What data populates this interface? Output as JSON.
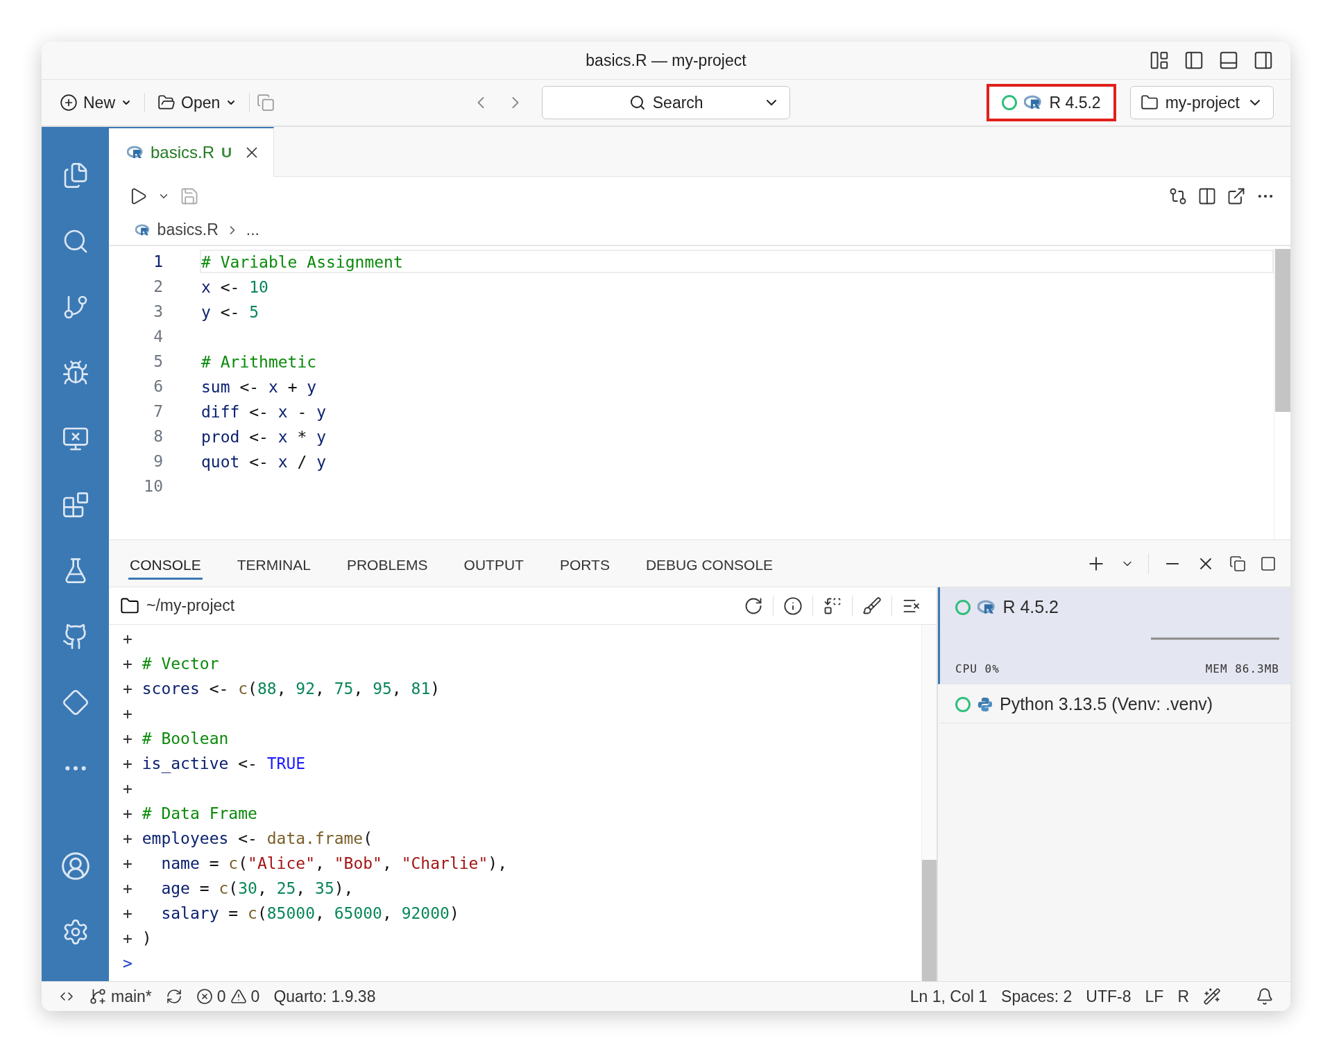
{
  "window": {
    "title": "basics.R — my-project"
  },
  "toolbar": {
    "new_button": "New",
    "open_button": "Open",
    "search": {
      "label": "Search"
    },
    "runtime": {
      "label": "R 4.5.2",
      "highlighted": true
    },
    "project": "my-project"
  },
  "editor": {
    "tab": {
      "label": "basics.R",
      "status": "U",
      "selected": true
    },
    "breadcrumb": [
      "basics.R",
      "..."
    ],
    "lines": [
      {
        "number": "1",
        "current": true,
        "tokens": [
          {
            "kind": "comment",
            "text": "# Variable Assignment"
          }
        ]
      },
      {
        "number": "2",
        "current": false,
        "tokens": [
          {
            "kind": "ident",
            "text": "x"
          },
          {
            "kind": "plain",
            "text": " <- "
          },
          {
            "kind": "number",
            "text": "10"
          }
        ]
      },
      {
        "number": "3",
        "current": false,
        "tokens": [
          {
            "kind": "ident",
            "text": "y"
          },
          {
            "kind": "plain",
            "text": " <- "
          },
          {
            "kind": "number",
            "text": "5"
          }
        ]
      },
      {
        "number": "4",
        "current": false
      },
      {
        "number": "5",
        "current": false,
        "tokens": [
          {
            "kind": "comment",
            "text": "# Arithmetic"
          }
        ]
      },
      {
        "number": "6",
        "current": false,
        "tokens": [
          {
            "kind": "ident",
            "text": "sum"
          },
          {
            "kind": "plain",
            "text": " <- "
          },
          {
            "kind": "ident",
            "text": "x"
          },
          {
            "kind": "plain",
            "text": " + "
          },
          {
            "kind": "ident",
            "text": "y"
          }
        ]
      },
      {
        "number": "7",
        "current": false,
        "tokens": [
          {
            "kind": "ident",
            "text": "diff"
          },
          {
            "kind": "plain",
            "text": " <- "
          },
          {
            "kind": "ident",
            "text": "x"
          },
          {
            "kind": "plain",
            "text": " - "
          },
          {
            "kind": "ident",
            "text": "y"
          }
        ]
      },
      {
        "number": "8",
        "current": false,
        "tokens": [
          {
            "kind": "ident",
            "text": "prod"
          },
          {
            "kind": "plain",
            "text": " <- "
          },
          {
            "kind": "ident",
            "text": "x"
          },
          {
            "kind": "plain",
            "text": " * "
          },
          {
            "kind": "ident",
            "text": "y"
          }
        ]
      },
      {
        "number": "9",
        "current": false,
        "tokens": [
          {
            "kind": "ident",
            "text": "quot"
          },
          {
            "kind": "plain",
            "text": " <- "
          },
          {
            "kind": "ident",
            "text": "x"
          },
          {
            "kind": "plain",
            "text": " / "
          },
          {
            "kind": "ident",
            "text": "y"
          }
        ]
      },
      {
        "number": "10",
        "current": false
      }
    ]
  },
  "panel": {
    "tabs": [
      {
        "label": "CONSOLE",
        "selected": true
      },
      {
        "label": "TERMINAL",
        "selected": false
      },
      {
        "label": "PROBLEMS",
        "selected": false
      },
      {
        "label": "OUTPUT",
        "selected": false
      },
      {
        "label": "PORTS",
        "selected": false
      },
      {
        "label": "DEBUG CONSOLE",
        "selected": false
      }
    ]
  },
  "console": {
    "path": "~/my-project",
    "lines": [
      {
        "kind": "continuation",
        "prompt": "+"
      },
      {
        "kind": "continuation",
        "prompt": "+",
        "tokens": [
          {
            "kind": "comment",
            "text": "# Vector"
          }
        ]
      },
      {
        "kind": "continuation",
        "prompt": "+",
        "tokens": [
          {
            "kind": "ident",
            "text": "scores"
          },
          {
            "kind": "plain",
            "text": " <- "
          },
          {
            "kind": "func",
            "text": "c"
          },
          {
            "kind": "plain",
            "text": "("
          },
          {
            "kind": "number",
            "text": "88"
          },
          {
            "kind": "plain",
            "text": ", "
          },
          {
            "kind": "number",
            "text": "92"
          },
          {
            "kind": "plain",
            "text": ", "
          },
          {
            "kind": "number",
            "text": "75"
          },
          {
            "kind": "plain",
            "text": ", "
          },
          {
            "kind": "number",
            "text": "95"
          },
          {
            "kind": "plain",
            "text": ", "
          },
          {
            "kind": "number",
            "text": "81"
          },
          {
            "kind": "plain",
            "text": ")"
          }
        ]
      },
      {
        "kind": "continuation",
        "prompt": "+"
      },
      {
        "kind": "continuation",
        "prompt": "+",
        "tokens": [
          {
            "kind": "comment",
            "text": "# Boolean"
          }
        ]
      },
      {
        "kind": "continuation",
        "prompt": "+",
        "tokens": [
          {
            "kind": "ident",
            "text": "is_active"
          },
          {
            "kind": "plain",
            "text": " <- "
          },
          {
            "kind": "keyword",
            "text": "TRUE"
          }
        ]
      },
      {
        "kind": "continuation",
        "prompt": "+"
      },
      {
        "kind": "continuation",
        "prompt": "+",
        "tokens": [
          {
            "kind": "comment",
            "text": "# Data Frame"
          }
        ]
      },
      {
        "kind": "continuation",
        "prompt": "+",
        "tokens": [
          {
            "kind": "ident",
            "text": "employees"
          },
          {
            "kind": "plain",
            "text": " <- "
          },
          {
            "kind": "func",
            "text": "data.frame"
          },
          {
            "kind": "plain",
            "text": "("
          }
        ]
      },
      {
        "kind": "continuation",
        "prompt": "+",
        "indented": true,
        "tokens": [
          {
            "kind": "ident",
            "text": "name"
          },
          {
            "kind": "plain",
            "text": " = "
          },
          {
            "kind": "func",
            "text": "c"
          },
          {
            "kind": "plain",
            "text": "("
          },
          {
            "kind": "string",
            "text": "\"Alice\""
          },
          {
            "kind": "plain",
            "text": ", "
          },
          {
            "kind": "string",
            "text": "\"Bob\""
          },
          {
            "kind": "plain",
            "text": ", "
          },
          {
            "kind": "string",
            "text": "\"Charlie\""
          },
          {
            "kind": "plain",
            "text": "),"
          }
        ]
      },
      {
        "kind": "continuation",
        "prompt": "+",
        "indented": true,
        "tokens": [
          {
            "kind": "ident",
            "text": "age"
          },
          {
            "kind": "plain",
            "text": " = "
          },
          {
            "kind": "func",
            "text": "c"
          },
          {
            "kind": "plain",
            "text": "("
          },
          {
            "kind": "number",
            "text": "30"
          },
          {
            "kind": "plain",
            "text": ", "
          },
          {
            "kind": "number",
            "text": "25"
          },
          {
            "kind": "plain",
            "text": ", "
          },
          {
            "kind": "number",
            "text": "35"
          },
          {
            "kind": "plain",
            "text": "),"
          }
        ]
      },
      {
        "kind": "continuation",
        "prompt": "+",
        "indented": true,
        "tokens": [
          {
            "kind": "ident",
            "text": "salary"
          },
          {
            "kind": "plain",
            "text": " = "
          },
          {
            "kind": "func",
            "text": "c"
          },
          {
            "kind": "plain",
            "text": "("
          },
          {
            "kind": "number",
            "text": "85000"
          },
          {
            "kind": "plain",
            "text": ", "
          },
          {
            "kind": "number",
            "text": "65000"
          },
          {
            "kind": "plain",
            "text": ", "
          },
          {
            "kind": "number",
            "text": "92000"
          },
          {
            "kind": "plain",
            "text": ")"
          }
        ]
      },
      {
        "kind": "continuation",
        "prompt": "+",
        "tokens": [
          {
            "kind": "plain",
            "text": ")"
          }
        ]
      },
      {
        "kind": "input",
        "prompt": ">"
      }
    ]
  },
  "sessions": [
    {
      "name": "R 4.5.2",
      "kind": "r",
      "selected": true,
      "cpu": "CPU 0%",
      "mem": "MEM 86.3MB"
    },
    {
      "name": "Python 3.13.5 (Venv: .venv)",
      "kind": "python",
      "selected": false
    }
  ],
  "status_bar": {
    "branch": "main*",
    "errors": "0",
    "warnings": "0",
    "quarto": "Quarto: 1.9.38",
    "right": [
      "Ln 1, Col 1",
      "Spaces: 2",
      "UTF-8",
      "LF",
      "R"
    ]
  }
}
